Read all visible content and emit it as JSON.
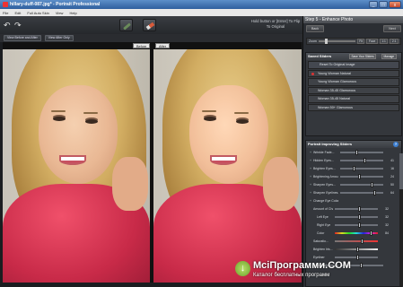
{
  "window": {
    "title": "hillary-duff-087.jpg* - Portrait Professional",
    "min": "_",
    "max": "□",
    "close": "x"
  },
  "menu": [
    "File",
    "Edit",
    "Full Auto Skin",
    "View",
    "Help"
  ],
  "toolbar": {
    "undo_glyph": "↶",
    "redo_glyph": "↷",
    "hold_text": "Hold button or [Enter] To Flip To Original"
  },
  "subbar": {
    "before_after": "View Before and After",
    "after_only": "View After Only"
  },
  "panes": {
    "before_label": "Before",
    "after_label": "After"
  },
  "panel": {
    "step_title": "Step 5 - Enhance Photo",
    "back": "Back",
    "next": "Next",
    "zoom_label": "Zoom",
    "zoom_buttons": [
      "Fit",
      "Face",
      "1:1",
      "2:1"
    ],
    "zoom_level_fraction": 0.18
  },
  "saved_sliders": {
    "title": "Saved Sliders",
    "save_btn": "Save Your Sliders",
    "manage_btn": "Manage",
    "reset": "Reset To Original Image",
    "items": [
      {
        "label": "Young Woman Natural",
        "dot": true
      },
      {
        "label": "Young Woman Glamorous",
        "dot": false
      },
      {
        "label": "Woman 35-45 Glamorous",
        "dot": false
      },
      {
        "label": "Woman 35-45 Natural",
        "dot": false
      },
      {
        "label": "Woman 50+ Glamorous",
        "dot": false
      }
    ]
  },
  "portrait_sliders": {
    "title": "Portrait Improving Sliders",
    "rows": [
      {
        "name": "Wrinkle Fade...",
        "value": "",
        "pos": 0.35,
        "level": 0
      },
      {
        "name": "Hidden Eyes...",
        "value": "41",
        "pos": 0.55,
        "level": 0
      },
      {
        "name": "Brighten Eyes...",
        "value": "16",
        "pos": 0.3,
        "level": 0
      },
      {
        "name": "Brightening Amou...",
        "value": "24",
        "pos": 0.42,
        "level": 0
      },
      {
        "name": "Sharpen Eyes...",
        "value": "50",
        "pos": 0.7,
        "level": 0
      },
      {
        "name": "Sharpen Eyelines...",
        "value": "64",
        "pos": 0.78,
        "level": 0
      },
      {
        "name": "Change Eye Color",
        "value": "",
        "pos": null,
        "level": 0
      },
      {
        "name": "Amount of Change",
        "value": "32",
        "pos": 0.55,
        "level": 1
      },
      {
        "name": "Left Eye",
        "value": "32",
        "pos": 0.55,
        "level": 2
      },
      {
        "name": "Right Eye",
        "value": "32",
        "pos": 0.55,
        "level": 2
      },
      {
        "name": "Color",
        "value": "84",
        "pos": 0.82,
        "level": 2,
        "track": "color"
      },
      {
        "name": "Saturatio...",
        "value": "",
        "pos": 0.6,
        "level": 1,
        "track": "sat"
      },
      {
        "name": "Brighten Iris...",
        "value": "",
        "pos": 0.5,
        "level": 1,
        "track": "grey"
      },
      {
        "name": "Eyeliner",
        "value": "",
        "pos": 0.5,
        "level": 1
      },
      {
        "name": "Pupil Darkening Amo...",
        "value": "",
        "pos": 0.45,
        "level": 0
      }
    ]
  },
  "watermark": {
    "main": "MсіПрограмми.COM",
    "sub": "Каталог бесплатных программ"
  }
}
